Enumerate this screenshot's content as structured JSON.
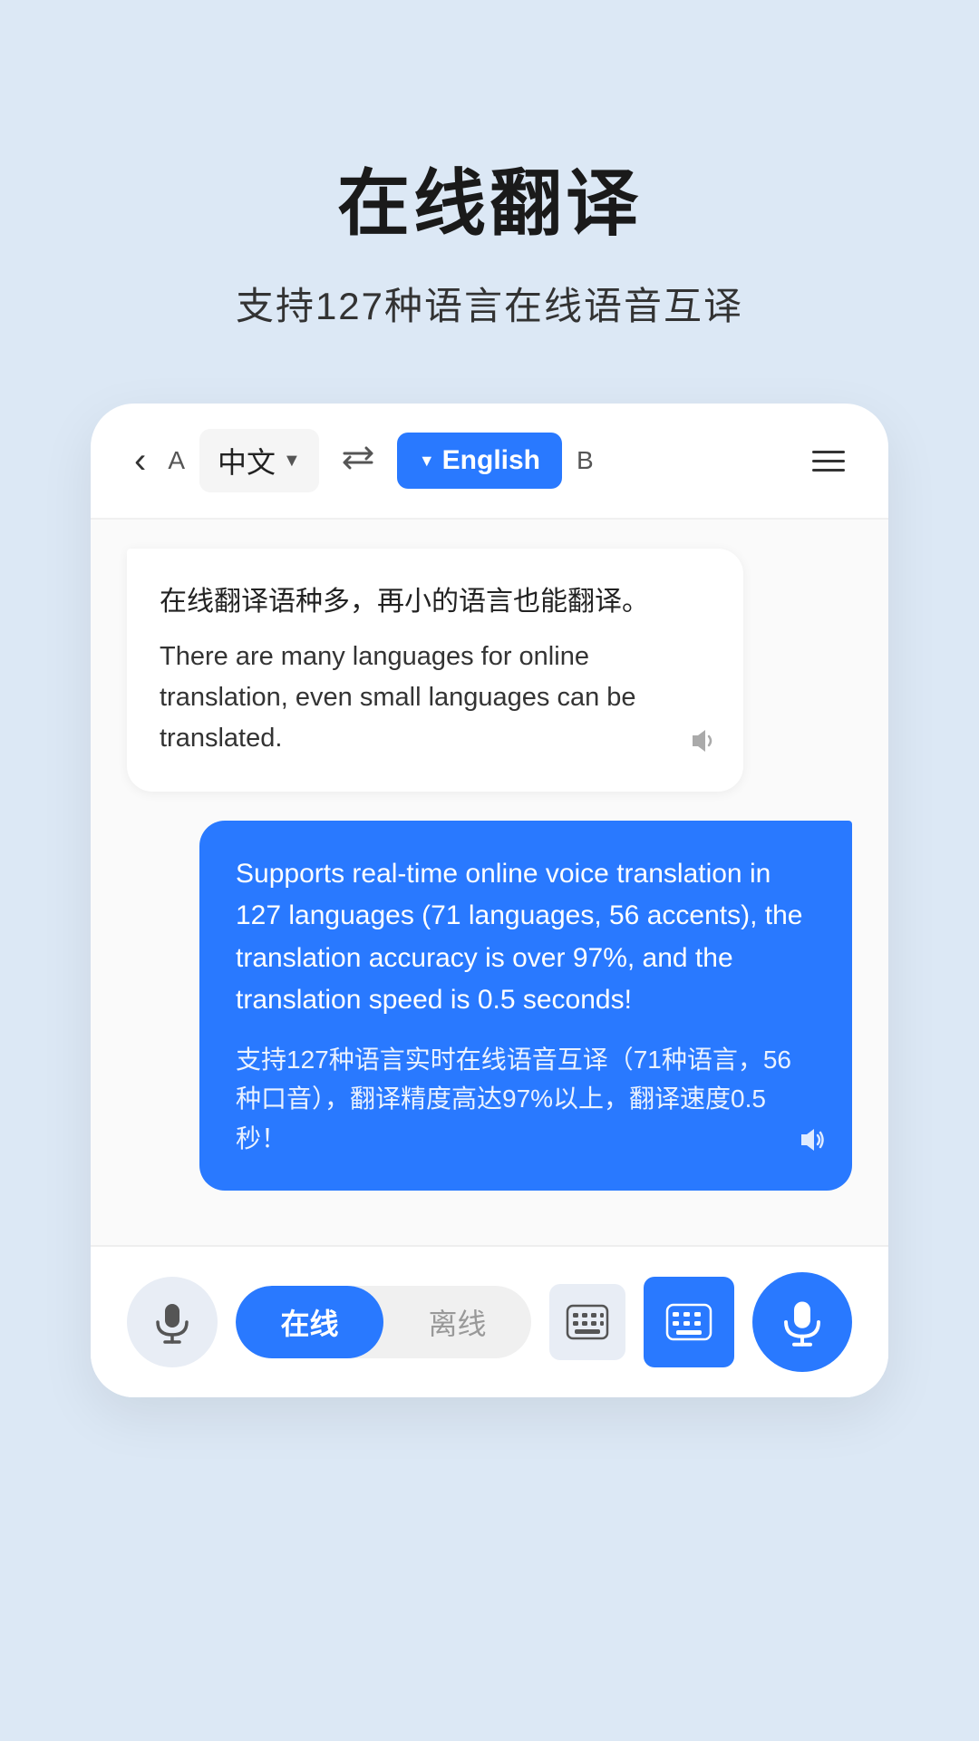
{
  "header": {
    "title": "在线翻译",
    "subtitle": "支持127种语言在线语音互译"
  },
  "navbar": {
    "back_icon": "‹",
    "lang_a_label": "A",
    "lang_source": "中文",
    "swap_icon": "⇌",
    "lang_target": "English",
    "lang_b_label": "B"
  },
  "chat": {
    "bubble_incoming": {
      "original": "在线翻译语种多，再小的语言也能翻译。",
      "translation": "There are many languages for online translation, even small languages can be translated."
    },
    "bubble_outgoing": {
      "english": "Supports real-time online voice translation in 127 languages (71 languages, 56 accents), the translation accuracy is over 97%, and the translation speed is 0.5 seconds!",
      "chinese": "支持127种语言实时在线语音互译（71种语言，56种口音），翻译精度高达97%以上，翻译速度0.5秒！"
    }
  },
  "bottom_bar": {
    "mode_online": "在线",
    "mode_offline": "离线"
  }
}
